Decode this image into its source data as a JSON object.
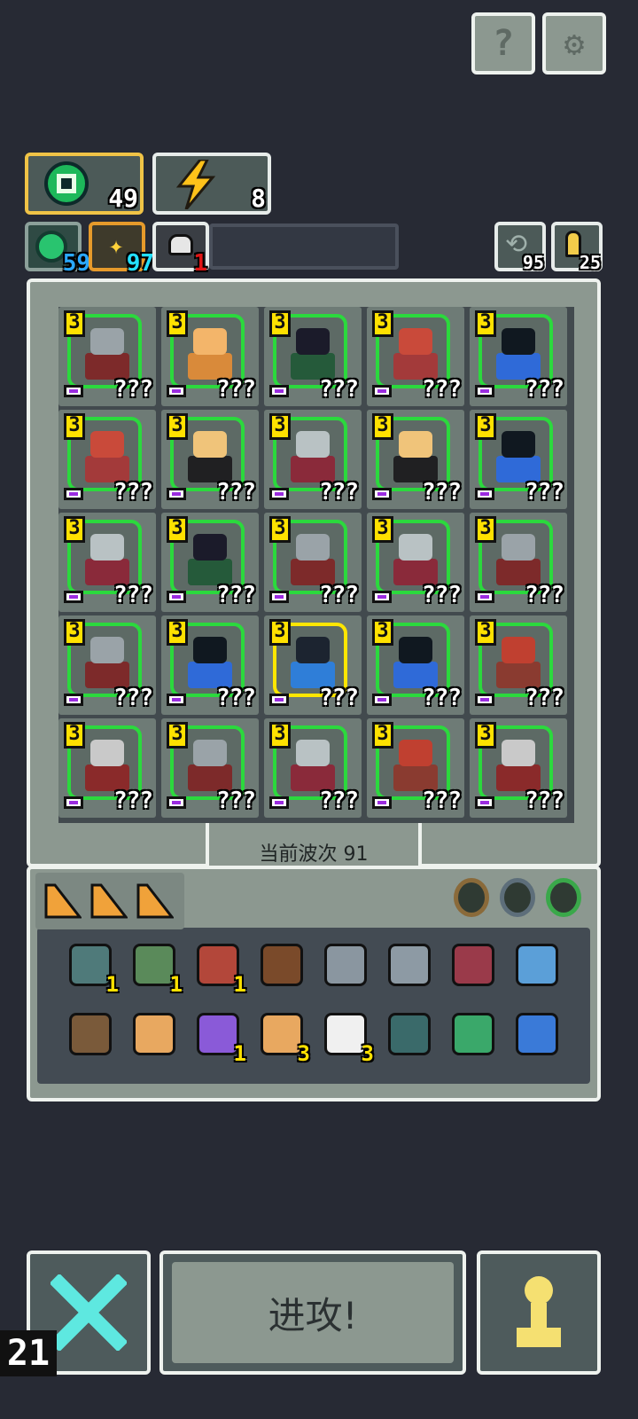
{
  "top_buttons": [
    {
      "name": "help-button",
      "icon": "question-icon",
      "label": "?"
    },
    {
      "name": "settings-button",
      "icon": "gear-icon",
      "label": "⚙"
    }
  ],
  "resources": {
    "gems": {
      "icon": "green-gem-icon",
      "value": "49"
    },
    "energy": {
      "icon": "lightning-icon",
      "value": "8"
    }
  },
  "stats": [
    {
      "icon": "green-orb-icon",
      "value": "59",
      "color": "#2aa8ff"
    },
    {
      "icon": "spark-icon",
      "value": "97",
      "color": "#23e0ff"
    },
    {
      "icon": "skull-icon",
      "value": "1",
      "color": "#e01515"
    }
  ],
  "side_counters": [
    {
      "icon": "recycle-icon",
      "value": "95"
    },
    {
      "icon": "key-icon",
      "value": "25"
    }
  ],
  "grid": {
    "unknown_label": "???",
    "level_label": "3",
    "units": [
      {
        "type": "knight"
      },
      {
        "type": "golem"
      },
      {
        "type": "witch"
      },
      {
        "type": "dwarf"
      },
      {
        "type": "shadow"
      },
      {
        "type": "dwarf"
      },
      {
        "type": "hunter"
      },
      {
        "type": "elf"
      },
      {
        "type": "hunter"
      },
      {
        "type": "shadow"
      },
      {
        "type": "elf"
      },
      {
        "type": "witch"
      },
      {
        "type": "knight"
      },
      {
        "type": "elf"
      },
      {
        "type": "knight"
      },
      {
        "type": "knight"
      },
      {
        "type": "shadow"
      },
      {
        "type": "mage",
        "selected": true
      },
      {
        "type": "shadow"
      },
      {
        "type": "bandit"
      },
      {
        "type": "soldier"
      },
      {
        "type": "knight"
      },
      {
        "type": "elf"
      },
      {
        "type": "bandit"
      },
      {
        "type": "soldier"
      }
    ]
  },
  "wave_label": "当前波次 91",
  "inventory": {
    "tabs": [
      "triangle-tab-icon",
      "triangle-tab-icon",
      "triangle-tab-icon"
    ],
    "filters": [
      "ring-filter-icon",
      "beetle-filter-icon",
      "gem-ring-filter-icon"
    ],
    "items": [
      {
        "icon": "heart-armor-icon",
        "count": "1"
      },
      {
        "icon": "goblin-icon",
        "count": "1"
      },
      {
        "icon": "fire-orb-icon",
        "count": "1"
      },
      {
        "icon": "chest-icon",
        "count": ""
      },
      {
        "icon": "stone-icon",
        "count": ""
      },
      {
        "icon": "rock-icon",
        "count": ""
      },
      {
        "icon": "ribbon-icon",
        "count": ""
      },
      {
        "icon": "branch-icon",
        "count": ""
      },
      {
        "icon": "star-wand-icon",
        "count": ""
      },
      {
        "icon": "scroll-icon",
        "count": ""
      },
      {
        "icon": "magic-swirl-icon",
        "count": "1"
      },
      {
        "icon": "trophy-icon",
        "count": "3"
      },
      {
        "icon": "cloud-icon",
        "count": "3"
      },
      {
        "icon": "gauntlet-icon",
        "count": ""
      },
      {
        "icon": "potion-icon",
        "count": ""
      },
      {
        "icon": "ticket-icon",
        "count": ""
      }
    ]
  },
  "bottom": {
    "close_count": "21",
    "attack_label": "进攻!"
  }
}
